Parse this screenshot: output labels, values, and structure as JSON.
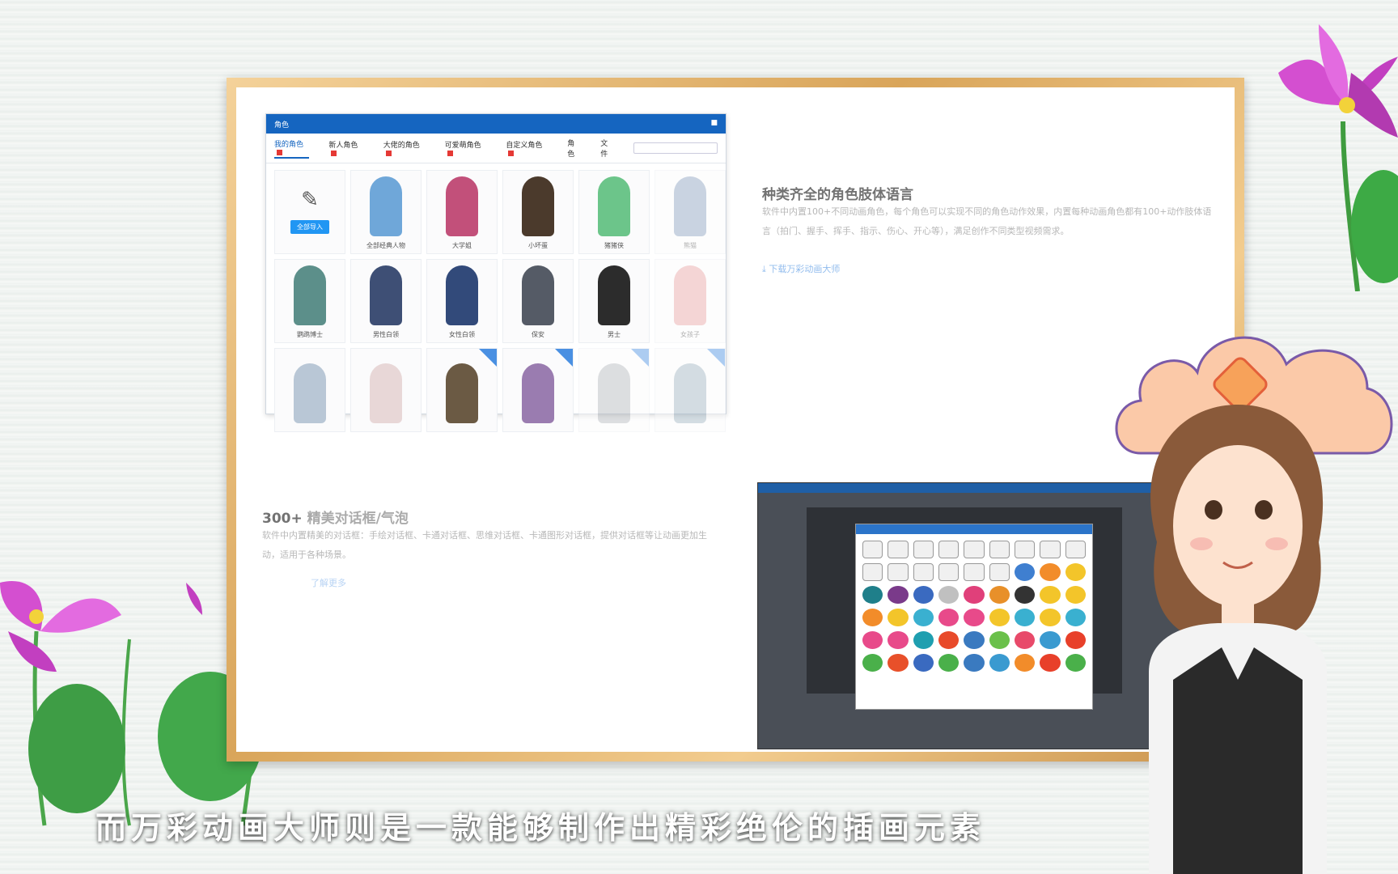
{
  "char_window": {
    "title": "角色",
    "tabs": [
      "我的角色",
      "新人角色",
      "大佬的角色",
      "可爱萌角色",
      "自定义角色",
      "角色",
      "文件"
    ],
    "cells": [
      {
        "label": "",
        "type": "import",
        "button": "全部导入"
      },
      {
        "label": "全部经典人物",
        "color": "#6fa7d9"
      },
      {
        "label": "大学姐",
        "color": "#c2507a"
      },
      {
        "label": "小坏蛋",
        "color": "#4b3a2c"
      },
      {
        "label": "猪猪侠",
        "color": "#6cc58a"
      },
      {
        "label": "熊猫",
        "color": "#8aa0bd"
      },
      {
        "label": "鹦鹉博士",
        "color": "#5c8f8a"
      },
      {
        "label": "男性白领",
        "color": "#3e4f75"
      },
      {
        "label": "女性白领",
        "color": "#324a7a"
      },
      {
        "label": "保安",
        "color": "#555b66"
      },
      {
        "label": "男士",
        "color": "#2c2c2c"
      },
      {
        "label": "女孩子",
        "color": "#e7a3a3"
      },
      {
        "label": "",
        "color": "#b9c7d6"
      },
      {
        "label": "",
        "color": "#e8d7d7"
      },
      {
        "label": "",
        "color": "#6b5a44"
      },
      {
        "label": "",
        "color": "#9a7cb0"
      },
      {
        "label": "",
        "color": "#b3b7bc"
      },
      {
        "label": "",
        "color": "#9fb3c0"
      }
    ]
  },
  "feature1": {
    "heading": "种类齐全的角色肢体语言",
    "text": "软件中内置100+不同动画角色，每个角色可以实现不同的角色动作效果，内置每种动画角色都有100+动作肢体语言（拍门、握手、挥手、指示、伤心、开心等），满足创作不同类型视频需求。",
    "link": "下载万彩动画大师"
  },
  "feature2": {
    "heading_num": "300+",
    "heading_text": "精美对话框/气泡",
    "text": "软件中内置精美的对话框：手绘对话框、卡通对话框、思维对话框、卡通图形对话框，提供对话框等让动画更加生动，适用于各种场景。",
    "link": "了解更多"
  },
  "caption": "而万彩动画大师则是一款能够制作出精彩绝伦的插画元素",
  "bubble_colors": [
    "#f0f0f0",
    "#f0f0f0",
    "#f0f0f0",
    "#f0f0f0",
    "#f0f0f0",
    "#f0f0f0",
    "#f0f0f0",
    "#f0f0f0",
    "#f0f0f0",
    "#f0f0f0",
    "#f0f0f0",
    "#f0f0f0",
    "#f0f0f0",
    "#f0f0f0",
    "#f0f0f0",
    "#3f7fd0",
    "#f28c2a",
    "#f3c52a",
    "#1f7f8a",
    "#7a3a8a",
    "#3a6ac0",
    "#c0c0c0",
    "#e0407a",
    "#e8902a",
    "#333333",
    "#f3c52a",
    "#f3c52a",
    "#f28c2a",
    "#f3c52a",
    "#3ab0d0",
    "#e84a8a",
    "#e84a8a",
    "#f3c52a",
    "#3ab0d0",
    "#f3c52a",
    "#3ab0d0",
    "#e84a8a",
    "#e84a8a",
    "#1f9fb0",
    "#e84a2a",
    "#3a7ac0",
    "#6ac04a",
    "#e84a6a",
    "#3a9ad0",
    "#e8402a",
    "#4ab04a",
    "#e8502a",
    "#3a6ac0",
    "#4ab04a",
    "#3a7ac0",
    "#3a9ad0",
    "#f28c2a",
    "#e8402a",
    "#4ab04a"
  ]
}
